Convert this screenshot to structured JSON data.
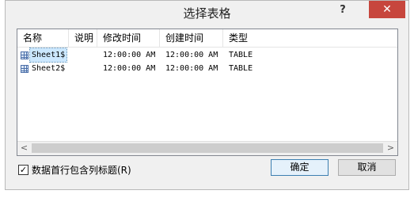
{
  "dialog": {
    "title": "选择表格",
    "help_label": "?",
    "close_label": "✕"
  },
  "list": {
    "columns": [
      "名称",
      "说明",
      "修改时间",
      "创建时间",
      "类型"
    ],
    "rows": [
      {
        "name": "Sheet1$",
        "description": "",
        "modified": "12:00:00 AM",
        "created": "12:00:00 AM",
        "type": "TABLE",
        "selected": true
      },
      {
        "name": "Sheet2$",
        "description": "",
        "modified": "12:00:00 AM",
        "created": "12:00:00 AM",
        "type": "TABLE",
        "selected": false
      }
    ],
    "scroll_left": "<",
    "scroll_right": ">"
  },
  "options": {
    "first_row_header_label": "数据首行包含列标题(R)",
    "first_row_header_checked": true,
    "check_mark": "✓"
  },
  "buttons": {
    "ok_label": "确定",
    "cancel_label": "取消"
  }
}
